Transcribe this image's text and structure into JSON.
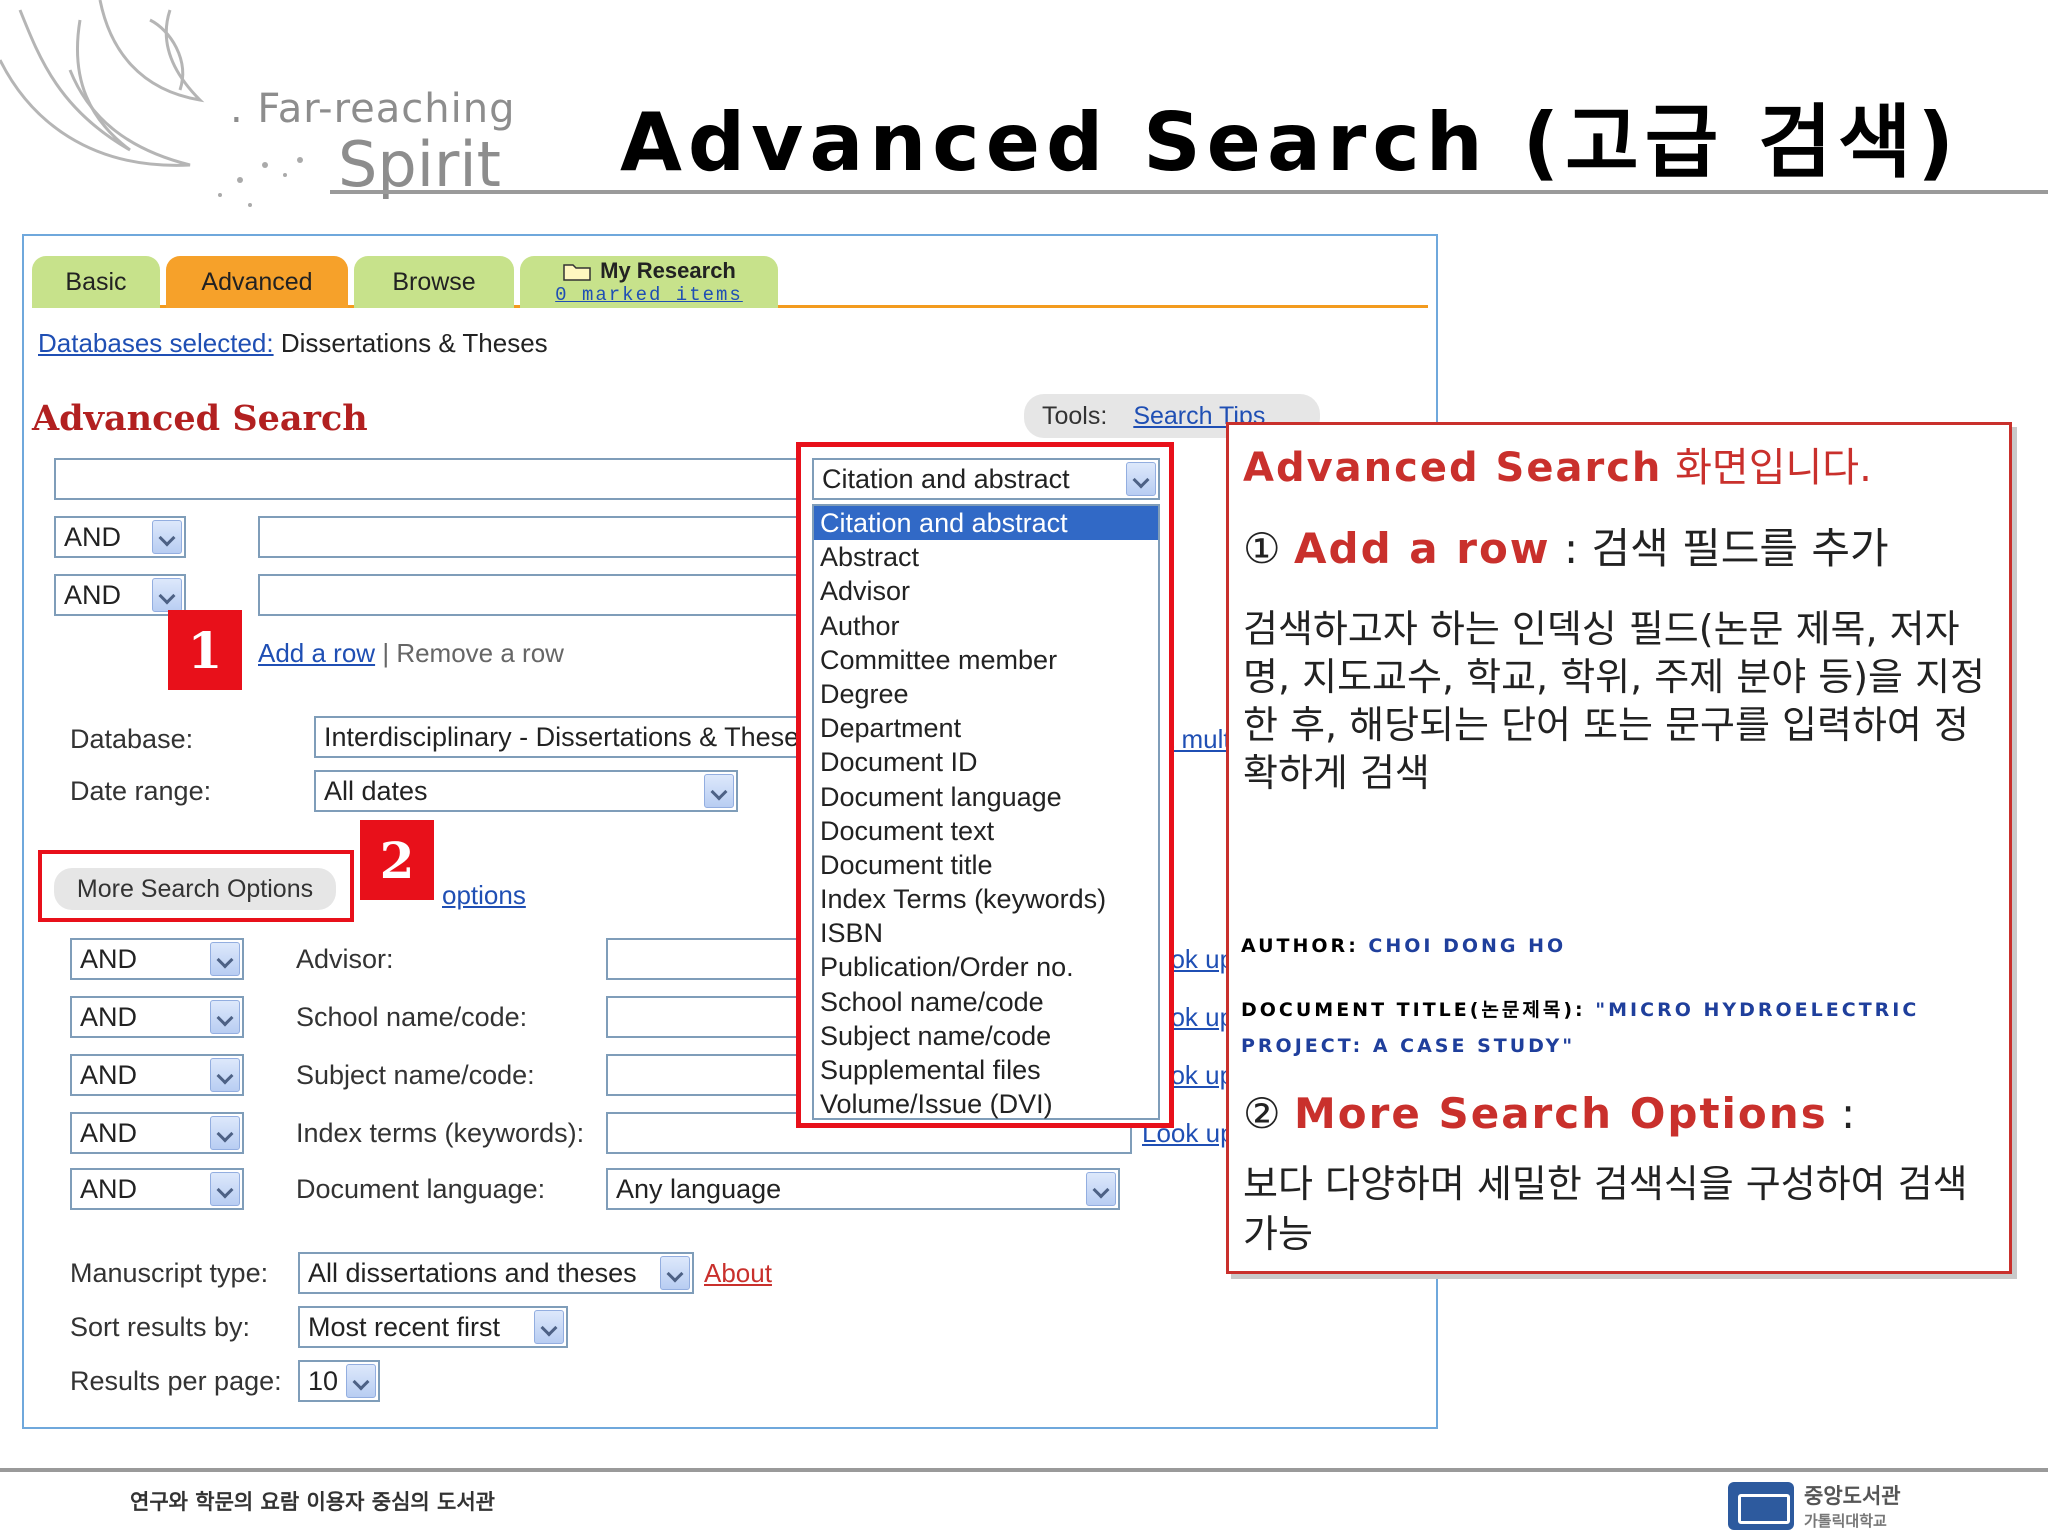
{
  "slide": {
    "logo_line1": ". Far-reaching",
    "logo_line2": "Spirit",
    "title": "Advanced Search (고급 검색)"
  },
  "tabs": {
    "basic": "Basic",
    "advanced": "Advanced",
    "browse": "Browse",
    "research": "My Research",
    "research_sub": "0 marked items"
  },
  "databases": {
    "link": "Databases selected:",
    "value": "Dissertations & Theses"
  },
  "search": {
    "heading": "Advanced Search",
    "tools_label": "Tools:",
    "tools_link": "Search Tips",
    "field_select": "Citation and abstract",
    "row_ops": [
      "AND",
      "AND"
    ],
    "add_row": "Add a row",
    "separator": "|",
    "remove_row": "Remove a row"
  },
  "filters": {
    "database_label": "Database:",
    "database_value": "Interdisciplinary - Dissertations & These",
    "database_link": "ct mult",
    "date_label": "Date range:",
    "date_value": "All dates",
    "more_button": "More Search Options",
    "fewer_link": "options"
  },
  "more_rows": [
    {
      "op": "AND",
      "label": "Advisor:",
      "lookup": "ook up"
    },
    {
      "op": "AND",
      "label": "School name/code:",
      "lookup": "ook up"
    },
    {
      "op": "AND",
      "label": "Subject name/code:",
      "lookup": "ook up"
    },
    {
      "op": "AND",
      "label": "Index terms (keywords):",
      "lookup": "Look up"
    },
    {
      "op": "AND",
      "label": "Document language:",
      "value": "Any language"
    }
  ],
  "bottom": {
    "manuscript_label": "Manuscript type:",
    "manuscript_value": "All dissertations and theses",
    "about_link": "About",
    "sort_label": "Sort results by:",
    "sort_value": "Most recent first",
    "perpage_label": "Results per page:",
    "perpage_value": "10"
  },
  "dropdown": {
    "items": [
      "Citation and abstract",
      "Abstract",
      "Advisor",
      "Author",
      "Committee member",
      "Degree",
      "Department",
      "Document ID",
      "Document language",
      "Document text",
      "Document title",
      "Index Terms (keywords)",
      "ISBN",
      "Publication/Order no.",
      "School name/code",
      "Subject name/code",
      "Supplemental files",
      "Volume/Issue (DVI)"
    ],
    "selected_index": 0
  },
  "markers": {
    "one": "1",
    "two": "2"
  },
  "panel": {
    "title_en": "Advanced Search",
    "title_ko": " 화면입니다.",
    "s1_num": "① ",
    "s1_title": "Add a row",
    "s1_rest": " : 검색 필드를 추가",
    "s1_body": "검색하고자 하는 인덱싱 필드(논문 제목, 저자명, 지도교수, 학교, 학위, 주제 분야 등)을 지정한 후, 해당되는 단어 또는 문구를 입력하여 정확하게 검색",
    "ex1_label": "AUTHOR: ",
    "ex1_value": "CHOI DONG HO",
    "ex2_label": "DOCUMENT TITLE(논문제목): ",
    "ex2_value": "\"MICRO HYDROELECTRIC",
    "ex2_value2": "PROJECT: A CASE STUDY\"",
    "s2_num": "② ",
    "s2_title": "More Search Options",
    "s2_rest": " :",
    "s2_body": "보다 다양하며 세밀한 검색식을 구성하여 검색 가능"
  },
  "footer": {
    "text": "연구와 학문의 요람 이용자 중심의 도서관",
    "lib_name": "중앙도서관",
    "univ_name": "가톨릭대학교"
  },
  "colors": {
    "accent_red": "#e8101a",
    "tab_green": "#c7e28b",
    "tab_orange": "#f6a12a",
    "link_blue": "#1f4fb4",
    "heading_red": "#b22020"
  }
}
